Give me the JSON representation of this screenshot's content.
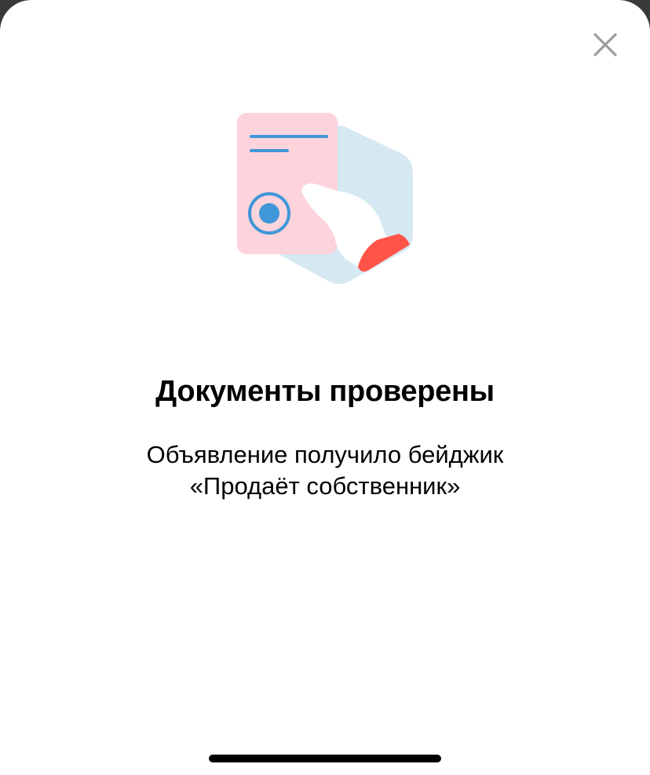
{
  "modal": {
    "title": "Документы проверены",
    "description_line1": "Объявление получило бейджик",
    "description_line2": "«Продаёт собственник»"
  },
  "icons": {
    "close": "close-icon",
    "illustration": "verified-document-hand-illustration"
  },
  "colors": {
    "background": "#ffffff",
    "document": "#fdd3dc",
    "hexagon": "#d6e9f2",
    "accent_blue": "#3f97d8",
    "sleeve_red": "#ff5447",
    "close_icon": "#9b9b9b"
  }
}
